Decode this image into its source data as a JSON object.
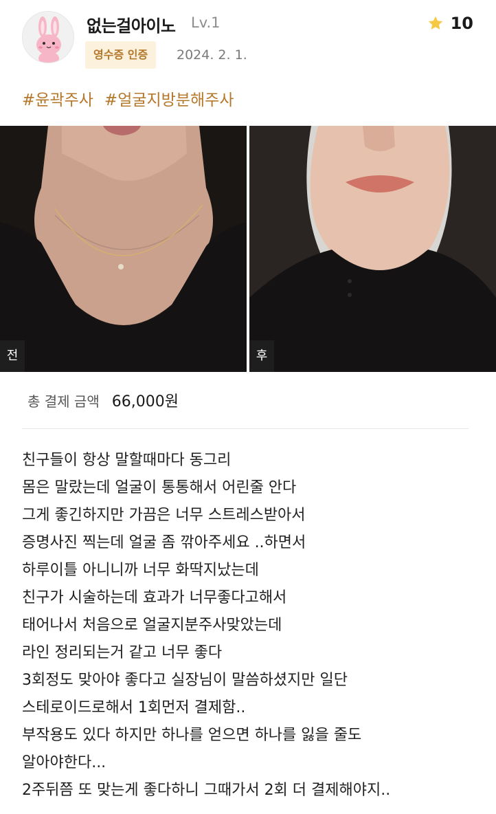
{
  "user": {
    "nickname": "없는걸아이노",
    "level": "Lv.1",
    "badge": "영수증 인증",
    "date": "2024. 2. 1."
  },
  "rating": {
    "value": "10",
    "icon": "star-icon",
    "color": "#f6c844"
  },
  "tags": [
    "#윤곽주사",
    "#얼굴지방분해주사"
  ],
  "photos": {
    "before_label": "전",
    "after_label": "후"
  },
  "payment": {
    "label": "총 결제 금액",
    "amount": "66,000원"
  },
  "review_lines": [
    "친구들이 항상 말할때마다 동그리",
    "몸은 말랐는데 얼굴이 통통해서 어린줄 안다",
    "그게 좋긴하지만 가끔은 너무 스트레스받아서",
    "증명사진 찍는데 얼굴 좀 깎아주세요 ..하면서",
    "하루이틀 아니니까 너무 화딱지났는데",
    "친구가 시술하는데 효과가 너무좋다고해서",
    "태어나서 처음으로 얼굴지분주사맞았는데",
    "라인 정리되는거 같고 너무 좋다",
    "3회정도 맞아야 좋다고 실장님이 말씀하셨지만 일단",
    "스테로이드로해서 1회먼저 결제함..",
    "부작용도 있다 하지만 하나를 얻으면 하나를 잃을 줄도",
    "알아야한다...",
    "2주뒤쯤 또 맞는게 좋다하니 그때가서 2회 더 결제해야지.."
  ],
  "colors": {
    "accent": "#b5782b",
    "badge_bg": "#fbf1dd"
  }
}
